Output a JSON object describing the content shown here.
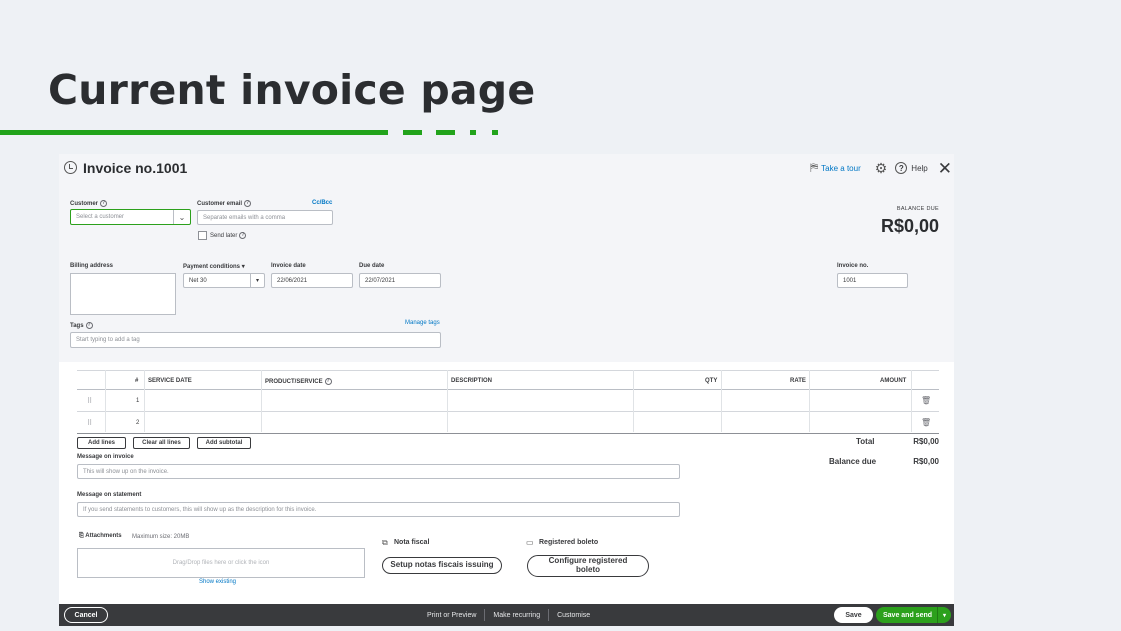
{
  "slide": {
    "title": "Current invoice page"
  },
  "header": {
    "title": "Invoice no.1001",
    "take_tour": "Take a tour",
    "help": "Help"
  },
  "customer": {
    "label": "Customer",
    "placeholder": "Select a customer"
  },
  "email": {
    "label": "Customer email",
    "placeholder": "Separate emails with a comma",
    "cc_bcc": "Cc/Bcc",
    "send_later": "Send later"
  },
  "balance": {
    "label": "BALANCE DUE",
    "value": "R$0,00"
  },
  "billing": {
    "label": "Billing address"
  },
  "payment": {
    "label": "Payment conditions",
    "value": "Net 30"
  },
  "invoice_date": {
    "label": "Invoice date",
    "value": "22/06/2021"
  },
  "due_date": {
    "label": "Due date",
    "value": "22/07/2021"
  },
  "invoice_no": {
    "label": "Invoice no.",
    "value": "1001"
  },
  "tags": {
    "label": "Tags",
    "manage": "Manage tags",
    "placeholder": "Start typing to add a tag"
  },
  "table": {
    "columns": [
      "#",
      "SERVICE DATE",
      "PRODUCT/SERVICE",
      "DESCRIPTION",
      "QTY",
      "RATE",
      "AMOUNT"
    ],
    "rows": [
      "1",
      "2"
    ]
  },
  "buttons": {
    "add_lines": "Add lines",
    "clear_lines": "Clear all lines",
    "add_subtotal": "Add subtotal"
  },
  "totals": {
    "total_label": "Total",
    "total_value": "R$0,00",
    "balance_label": "Balance due",
    "balance_value": "R$0,00"
  },
  "message_invoice": {
    "label": "Message on invoice",
    "placeholder": "This will show up on the invoice."
  },
  "message_statement": {
    "label": "Message on statement",
    "placeholder": "If you send statements to customers, this will show up as the description for this invoice."
  },
  "attachments": {
    "label": "Attachments",
    "max_size": "Maximum size: 20MB",
    "drop_text": "Drag/Drop files here or click the icon",
    "show_existing": "Show existing"
  },
  "nota": {
    "label": "Nota fiscal",
    "button": "Setup notas fiscais issuing"
  },
  "boleto": {
    "label": "Registered boleto",
    "button": "Configure registered boleto"
  },
  "footer": {
    "cancel": "Cancel",
    "print": "Print or Preview",
    "recurring": "Make recurring",
    "customise": "Customise",
    "save": "Save",
    "save_send": "Save and send"
  },
  "colors": {
    "green": "#2ca01c",
    "accent_line": "#22a31b",
    "link": "#0077c5",
    "footer_bg": "#393a3d"
  }
}
